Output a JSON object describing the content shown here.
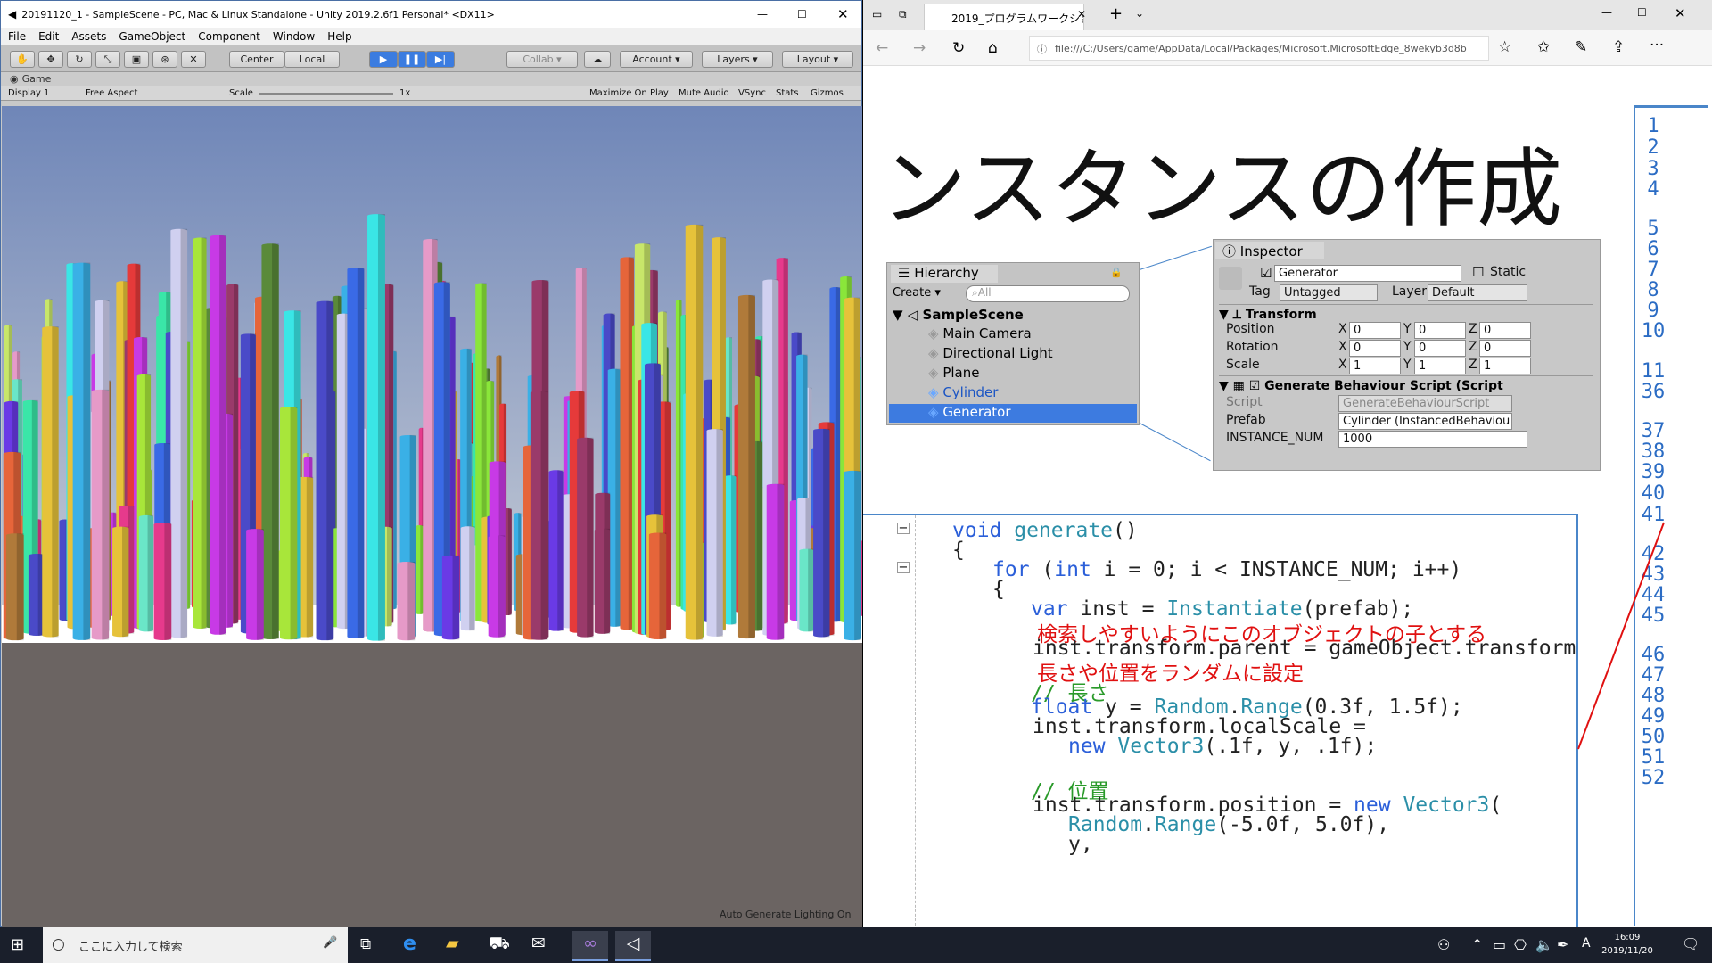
{
  "unity": {
    "title": "20191120_1 - SampleScene - PC, Mac & Linux Standalone - Unity 2019.2.6f1 Personal* <DX11>",
    "menu": [
      "File",
      "Edit",
      "Assets",
      "GameObject",
      "Component",
      "Window",
      "Help"
    ],
    "toolbar": {
      "center": "Center",
      "local": "Local",
      "collab": "Collab",
      "account": "Account",
      "layers": "Layers",
      "layout": "Layout"
    },
    "game_tab": "Game",
    "game_bar": {
      "display": "Display 1",
      "aspect": "Free Aspect",
      "scale": "Scale",
      "scale_value": "1x",
      "maximize": "Maximize On Play",
      "mute": "Mute Audio",
      "vsync": "VSync",
      "stats": "Stats",
      "gizmos": "Gizmos"
    },
    "status": "Auto Generate Lighting On",
    "colors": {
      "sky_top": "#6f86b8",
      "sky_bottom": "#c8cdd6",
      "ground": "#6b6462",
      "ground_light": "#ffffff"
    }
  },
  "edge": {
    "tab_title": "2019_プログラムワークショッ",
    "address": "file:///C:/Users/game/AppData/Local/Packages/Microsoft.MicrosoftEdge_8wekyb3d8b",
    "slide_title": "ンスタンスの作成",
    "hierarchy": {
      "tab": "Hierarchy",
      "create": "Create",
      "search_placeholder": "All",
      "scene": "SampleScene",
      "items": [
        "Main Camera",
        "Directional Light",
        "Plane",
        "Cylinder",
        "Generator"
      ],
      "selected": "Generator"
    },
    "inspector": {
      "tab": "Inspector",
      "name": "Generator",
      "static": "Static",
      "tag_label": "Tag",
      "tag": "Untagged",
      "layer_label": "Layer",
      "layer": "Default",
      "transform": "Transform",
      "rows": [
        {
          "label": "Position",
          "x": "0",
          "y": "0",
          "z": "0"
        },
        {
          "label": "Rotation",
          "x": "0",
          "y": "0",
          "z": "0"
        },
        {
          "label": "Scale",
          "x": "1",
          "y": "1",
          "z": "1"
        }
      ],
      "axis": {
        "x": "X",
        "y": "Y",
        "z": "Z"
      },
      "script_comp": "Generate Behaviour Script (Script",
      "script_label": "Script",
      "script_value": "GenerateBehaviourScript",
      "prefab_label": "Prefab",
      "prefab_value": "Cylinder (InstancedBehaviou",
      "num_label": "INSTANCE_NUM",
      "num_value": "1000"
    },
    "line_numbers_top": [
      "1",
      "2",
      "3",
      "4",
      "5",
      "6",
      "7",
      "8",
      "9",
      "10",
      "11",
      "36",
      "37",
      "38",
      "39",
      "40",
      "41",
      "42",
      "43",
      "44",
      "45",
      "46",
      "47",
      "48",
      "49",
      "50",
      "51",
      "52"
    ],
    "code": [
      "void generate()",
      "{",
      "for (int i = 0; i < INSTANCE_NUM; i++)",
      "{",
      "var inst = Instantiate(prefab);",
      "検索しやすいようにこのオブジェクトの子とする",
      "inst.transform.parent = gameObject.transform;",
      "長さや位置をランダムに設定",
      "// 長さ",
      "float y = Random.Range(0.3f, 1.5f);",
      "inst.transform.localScale =",
      "new Vector3(.1f, y, .1f);",
      "// 位置",
      "inst.transform.position = new Vector3(",
      "Random.Range(-5.0f, 5.0f),",
      "y,"
    ]
  },
  "taskbar": {
    "search_placeholder": "ここに入力して検索",
    "time": "16:09",
    "date": "2019/11/20",
    "ime": "A"
  }
}
